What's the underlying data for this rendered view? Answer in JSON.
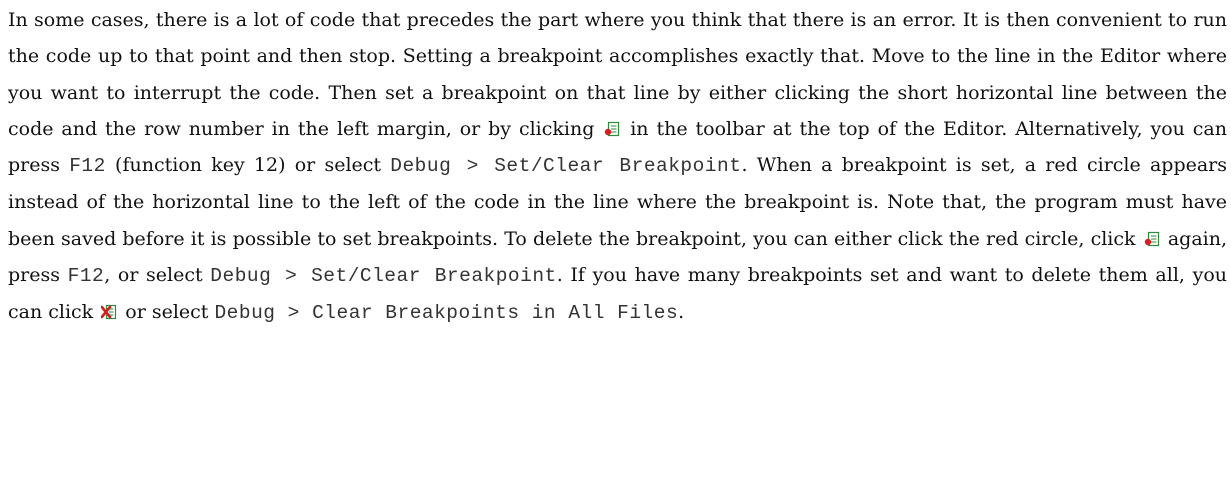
{
  "paragraph": {
    "s01": "In some cases, there is a lot of code that precedes the part where you think that there is an error. It is then convenient to run the code up to that point and then stop. Setting a breakpoint accomplishes exactly that. Move to the line in the Editor where you want to interrupt the code. Then set a breakpoint on that line by either clicking the short horizontal line between the code and the row number in the left margin, or by clicking ",
    "s02": " in the toolbar at the top of the Editor. Alternatively, you can press ",
    "key_f12_a": "F12",
    "s03": " (function key 12) or select ",
    "menu_set_clear_a": "Debug > Set/Clear Breakpoint",
    "s04": ". When a breakpoint is set, a red circle appears instead of the horizontal line to the left of the code in the line where the breakpoint is. Note that, the program must have been saved before it is possible to set breakpoints. To delete the breakpoint, you can either click the red circle, click ",
    "s05": " again, press ",
    "key_f12_b": "F12",
    "s06": ", or select ",
    "menu_set_clear_b": "Debug > Set/Clear Breakpoint",
    "s07": ". If you have many breakpoints set and want to delete them all, you can click ",
    "s08": " or select ",
    "menu_clear_all": "Debug > Clear Breakpoints in All Files",
    "s09": "."
  },
  "icons": {
    "set_breakpoint": "set-clear-breakpoint-icon",
    "clear_all_breakpoints": "clear-all-breakpoints-icon"
  },
  "colors": {
    "text": "#111111",
    "code_text": "#333333",
    "icon_green": "#2e8b3a",
    "icon_red": "#d21f1f"
  }
}
